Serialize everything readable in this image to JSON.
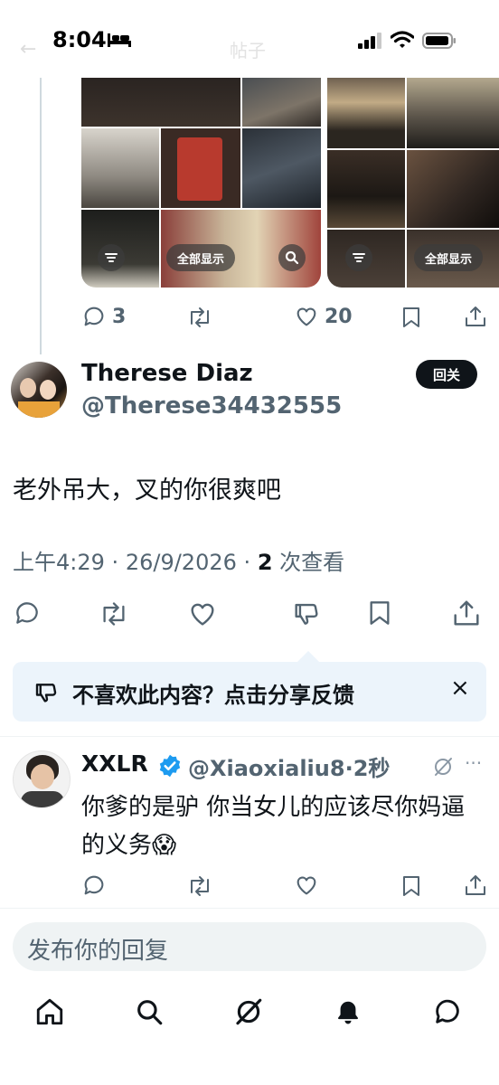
{
  "status_bar": {
    "time": "8:04"
  },
  "ghost_header": {
    "title": "帖子"
  },
  "quoted_post": {
    "grid_left": {
      "show_all_label": "全部显示"
    },
    "grid_right": {
      "show_all_label": "全部显示"
    },
    "actions": {
      "replies": "3",
      "likes": "20"
    }
  },
  "main_post": {
    "display_name": "Therese Diaz",
    "handle": "@Therese34432555",
    "follow_label": "回关",
    "text": "老外吊大，叉的你很爽吧",
    "time": "上午4:29",
    "date": "26/9/2026",
    "views_count": "2",
    "views_label": "次查看",
    "separator": "·"
  },
  "feedback": {
    "text": "不喜欢此内容？点击分享反馈",
    "close": "×"
  },
  "reply": {
    "display_name": "XXLR",
    "handle": "@Xiaoxialiu8",
    "separator": "·",
    "time_ago": "2秒",
    "more": "···",
    "text": "你爹的是驴 你当女儿的应该尽你妈逼的义务😱"
  },
  "composer": {
    "placeholder": "发布你的回复"
  },
  "tabs": [
    "home-icon",
    "search-icon",
    "grok-icon",
    "notifications-icon",
    "messages-icon"
  ],
  "colors": {
    "accent": "#1d9bf0",
    "text": "#0f1419",
    "muted": "#536471",
    "feedback_bg": "#ecf4fb"
  }
}
